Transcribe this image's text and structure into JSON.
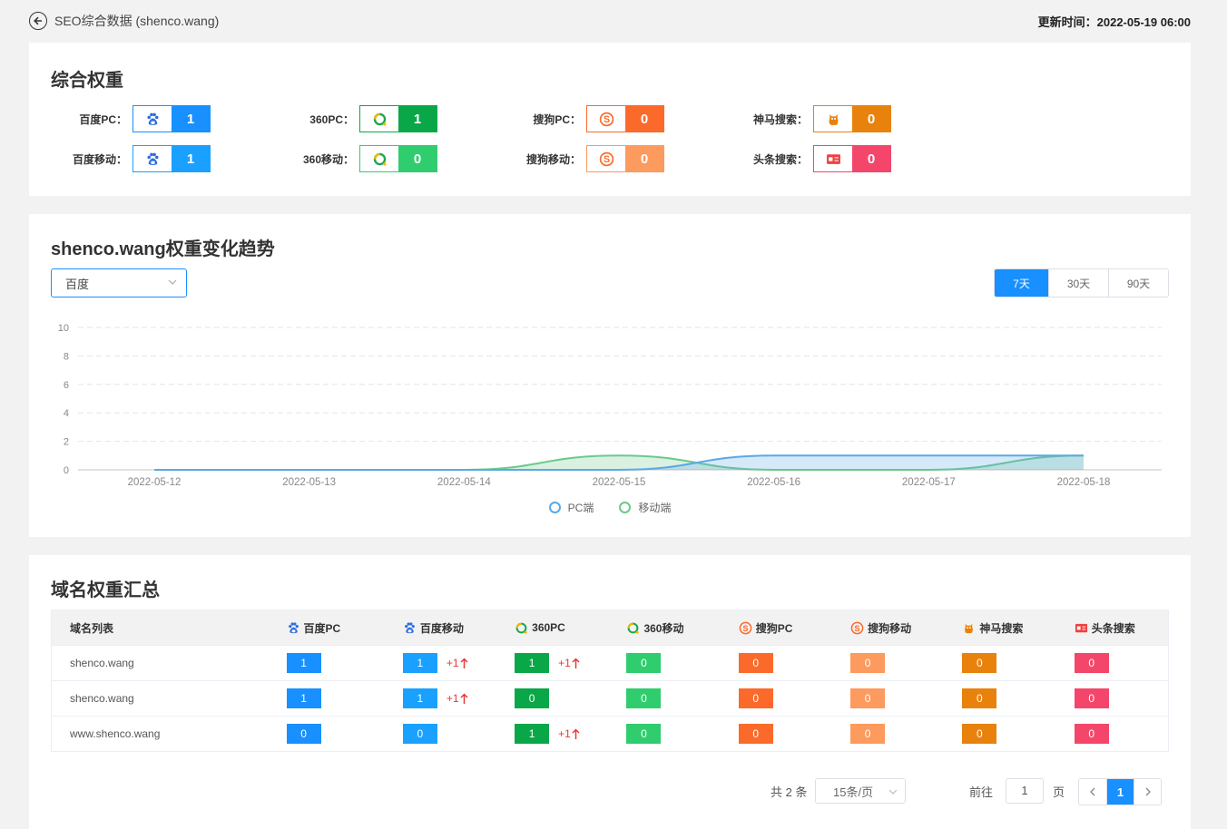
{
  "header": {
    "title": "SEO综合数据 (shenco.wang)",
    "updated_label": "更新时间：",
    "updated_value": "2022-05-19 06:00"
  },
  "weights": {
    "title": "综合权重",
    "items": [
      {
        "label": "百度PC：",
        "value": "1",
        "color": "#1890ff",
        "icon": "baidu-icon"
      },
      {
        "label": "360PC：",
        "value": "1",
        "color": "#0aa748",
        "icon": "360-icon"
      },
      {
        "label": "搜狗PC：",
        "value": "0",
        "color": "#fb6a2a",
        "icon": "sogou-icon"
      },
      {
        "label": "神马搜索：",
        "value": "0",
        "color": "#e8820c",
        "icon": "shenma-icon"
      },
      {
        "label": "百度移动：",
        "value": "1",
        "color": "#1aa1ff",
        "icon": "baidu-icon"
      },
      {
        "label": "360移动：",
        "value": "0",
        "color": "#2fcd6e",
        "icon": "360-icon"
      },
      {
        "label": "搜狗移动：",
        "value": "0",
        "color": "#fd9a5e",
        "icon": "sogou-icon"
      },
      {
        "label": "头条搜索：",
        "value": "0",
        "color": "#f4466a",
        "icon": "toutiao-icon"
      }
    ]
  },
  "trend": {
    "title": "shenco.wang权重变化趋势",
    "select_value": "百度",
    "ranges": [
      "7天",
      "30天",
      "90天"
    ],
    "active_range": "7天"
  },
  "chart_data": {
    "type": "area",
    "x": [
      "2022-05-12",
      "2022-05-13",
      "2022-05-14",
      "2022-05-15",
      "2022-05-16",
      "2022-05-17",
      "2022-05-18"
    ],
    "ylim": [
      0,
      10
    ],
    "yticks": [
      0,
      2,
      4,
      6,
      8,
      10
    ],
    "grid": true,
    "legend": "bottom-center",
    "series": [
      {
        "name": "PC端",
        "values": [
          0,
          0,
          0,
          0,
          1,
          1,
          1
        ],
        "color": "#5aa9e6"
      },
      {
        "name": "移动端",
        "values": [
          0,
          0,
          0,
          1,
          0,
          0,
          1
        ],
        "color": "#6cc98a"
      }
    ]
  },
  "summary": {
    "title": "域名权重汇总",
    "columns": [
      {
        "label": "域名列表",
        "icon": ""
      },
      {
        "label": "百度PC",
        "icon": "baidu-icon"
      },
      {
        "label": "百度移动",
        "icon": "baidu-icon"
      },
      {
        "label": "360PC",
        "icon": "360-icon"
      },
      {
        "label": "360移动",
        "icon": "360-icon"
      },
      {
        "label": "搜狗PC",
        "icon": "sogou-icon"
      },
      {
        "label": "搜狗移动",
        "icon": "sogou-icon"
      },
      {
        "label": "神马搜索",
        "icon": "shenma-icon"
      },
      {
        "label": "头条搜索",
        "icon": "toutiao-icon"
      }
    ],
    "rows": [
      {
        "domain": "shenco.wang",
        "cells": [
          {
            "v": "1",
            "d": ""
          },
          {
            "v": "1",
            "d": "+1"
          },
          {
            "v": "1",
            "d": "+1"
          },
          {
            "v": "0",
            "d": ""
          },
          {
            "v": "0",
            "d": ""
          },
          {
            "v": "0",
            "d": ""
          },
          {
            "v": "0",
            "d": ""
          },
          {
            "v": "0",
            "d": ""
          }
        ]
      },
      {
        "domain": "shenco.wang",
        "cells": [
          {
            "v": "1",
            "d": ""
          },
          {
            "v": "1",
            "d": "+1"
          },
          {
            "v": "0",
            "d": ""
          },
          {
            "v": "0",
            "d": ""
          },
          {
            "v": "0",
            "d": ""
          },
          {
            "v": "0",
            "d": ""
          },
          {
            "v": "0",
            "d": ""
          },
          {
            "v": "0",
            "d": ""
          }
        ]
      },
      {
        "domain": "www.shenco.wang",
        "cells": [
          {
            "v": "0",
            "d": ""
          },
          {
            "v": "0",
            "d": ""
          },
          {
            "v": "1",
            "d": "+1"
          },
          {
            "v": "0",
            "d": ""
          },
          {
            "v": "0",
            "d": ""
          },
          {
            "v": "0",
            "d": ""
          },
          {
            "v": "0",
            "d": ""
          },
          {
            "v": "0",
            "d": ""
          }
        ]
      }
    ],
    "column_colors": [
      "#1890ff",
      "#1aa1ff",
      "#0aa748",
      "#2fcd6e",
      "#fb6a2a",
      "#fd9a5e",
      "#e8820c",
      "#f4466a"
    ]
  },
  "pagination": {
    "total": "共 2 条",
    "page_size": "15条/页",
    "goto_label": "前往",
    "goto_value": "1",
    "page_word": "页",
    "current_page": "1"
  }
}
